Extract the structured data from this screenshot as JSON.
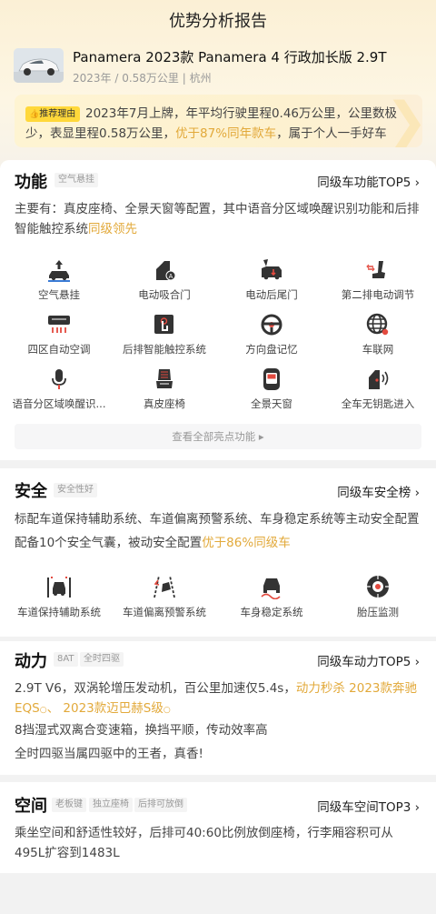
{
  "header": {
    "title": "优势分析报告"
  },
  "car": {
    "name": "Panamera 2023款 Panamera 4 行政加长版 2.9T",
    "meta": "2023年 / 0.58万公里 | 杭州"
  },
  "recommend": {
    "badge": "推荐理由",
    "text_a": "2023年7月上牌，年平均行驶里程0.46万公里，公里数极少，表显里程0.58万公里，",
    "highlight": "优于87%同年款车",
    "text_b": "，属于个人一手好车"
  },
  "function": {
    "title": "功能",
    "tag": "空气悬挂",
    "rank": "同级车功能TOP5 ›",
    "desc_a": "主要有：真皮座椅、全景天窗等配置，其中语音分区域唤醒识别功能和后排智能触控系统",
    "desc_hl": "同级领先",
    "items": [
      {
        "label": "空气悬挂",
        "icon": "air-suspension-icon"
      },
      {
        "label": "电动吸合门",
        "icon": "soft-close-door-icon"
      },
      {
        "label": "电动后尾门",
        "icon": "power-tailgate-icon"
      },
      {
        "label": "第二排电动调节",
        "icon": "power-seat-icon"
      },
      {
        "label": "四区自动空调",
        "icon": "climate-icon"
      },
      {
        "label": "后排智能触控系统",
        "icon": "touch-control-icon"
      },
      {
        "label": "方向盘记忆",
        "icon": "steering-wheel-icon"
      },
      {
        "label": "车联网",
        "icon": "globe-icon"
      },
      {
        "label": "语音分区域唤醒识...",
        "icon": "microphone-icon"
      },
      {
        "label": "真皮座椅",
        "icon": "leather-seat-icon"
      },
      {
        "label": "全景天窗",
        "icon": "sunroof-icon"
      },
      {
        "label": "全车无钥匙进入",
        "icon": "keyless-entry-icon"
      }
    ],
    "more": "查看全部亮点功能 ▸"
  },
  "safety": {
    "title": "安全",
    "tag": "安全性好",
    "rank": "同级车安全榜 ›",
    "line1": "标配车道保持辅助系统、车道偏离预警系统、车身稳定系统等主动安全配置",
    "line2_a": "配备10个安全气囊，被动安全配置",
    "line2_hl": "优于86%同级车",
    "items": [
      {
        "label": "车道保持辅助系统",
        "icon": "lane-keep-icon"
      },
      {
        "label": "车道偏离预警系统",
        "icon": "lane-departure-icon"
      },
      {
        "label": "车身稳定系统",
        "icon": "stability-icon"
      },
      {
        "label": "胎压监测",
        "icon": "tire-pressure-icon"
      }
    ]
  },
  "power": {
    "title": "动力",
    "tags": [
      "8AT",
      "全时四驱"
    ],
    "rank": "同级车动力TOP5 ›",
    "line1_a": "2.9T V6，双涡轮增压发动机，百公里加速仅5.4s，",
    "line1_hl1": "动力秒杀",
    "line1_hl2": "2023款奔驰EQS",
    "sep": "、",
    "line1_hl3": "2023款迈巴赫S级",
    "line2": "8挡湿式双离合变速箱，换挡平顺，传动效率高",
    "line3": "全时四驱当属四驱中的王者，真香!"
  },
  "space": {
    "title": "空间",
    "tags": [
      "老板键",
      "独立座椅",
      "后排可放倒"
    ],
    "rank": "同级车空间TOP3 ›",
    "desc": "乘坐空间和舒适性较好，后排可40:60比例放倒座椅，行李厢容积可从495L扩容到1483L"
  }
}
